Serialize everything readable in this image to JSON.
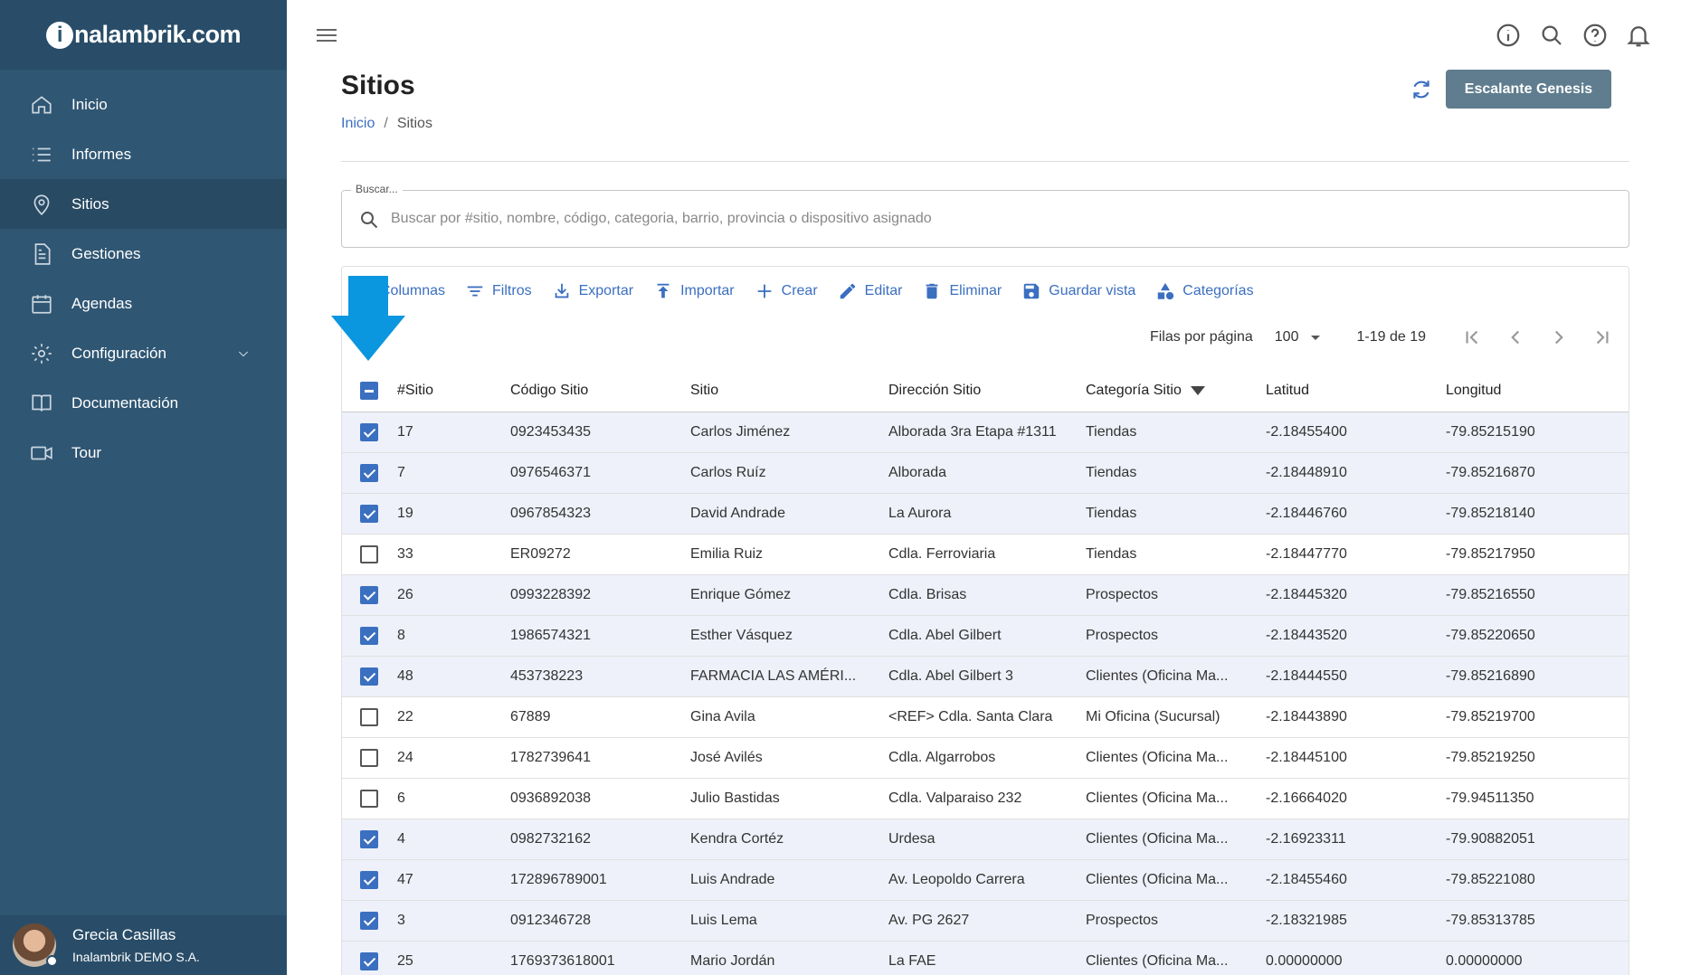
{
  "app": {
    "logo_text": "ınalambrik.com",
    "logo_letter": "i",
    "logo_rest": "nalambrik.com"
  },
  "sidebar": {
    "items": [
      {
        "label": "Inicio",
        "icon": "home-icon"
      },
      {
        "label": "Informes",
        "icon": "list-icon"
      },
      {
        "label": "Sitios",
        "icon": "location-pin-icon",
        "active": true
      },
      {
        "label": "Gestiones",
        "icon": "document-icon"
      },
      {
        "label": "Agendas",
        "icon": "calendar-icon"
      },
      {
        "label": "Configuración",
        "icon": "gear-icon"
      },
      {
        "label": "Documentación",
        "icon": "book-icon"
      },
      {
        "label": "Tour",
        "icon": "video-camera-icon"
      }
    ],
    "user": {
      "name": "Grecia Casillas",
      "org": "Inalambrik DEMO S.A."
    }
  },
  "header": {
    "title": "Sitios",
    "breadcrumb": {
      "home": "Inicio",
      "sep": "/",
      "current": "Sitios"
    },
    "action_button": "Escalante Genesis"
  },
  "search": {
    "label": "Buscar...",
    "placeholder": "Buscar por #sitio, nombre, código, categoria, barrio, provincia o dispositivo asignado",
    "value": ""
  },
  "toolbar": {
    "columnas": "Columnas",
    "filtros": "Filtros",
    "exportar": "Exportar",
    "importar": "Importar",
    "crear": "Crear",
    "editar": "Editar",
    "eliminar": "Eliminar",
    "guardar": "Guardar vista",
    "categorias": "Categorías"
  },
  "pager": {
    "rows_label": "Filas por página",
    "rows_value": "100",
    "range": "1-19 de 19"
  },
  "table": {
    "headers": [
      "#Sitio",
      "Código Sitio",
      "Sitio",
      "Dirección Sitio",
      "Categoría Sitio",
      "Latitud",
      "Longitud"
    ],
    "rows": [
      {
        "checked": true,
        "cells": [
          "17",
          "0923453435",
          "Carlos Jiménez",
          "Alborada 3ra Etapa #1311",
          "Tiendas",
          "-2.18455400",
          "-79.85215190"
        ]
      },
      {
        "checked": true,
        "cells": [
          "7",
          "0976546371",
          "Carlos Ruíz",
          "Alborada",
          "Tiendas",
          "-2.18448910",
          "-79.85216870"
        ]
      },
      {
        "checked": true,
        "cells": [
          "19",
          "0967854323",
          "David Andrade",
          "La Aurora",
          "Tiendas",
          "-2.18446760",
          "-79.85218140"
        ]
      },
      {
        "checked": false,
        "cells": [
          "33",
          "ER09272",
          "Emilia Ruiz",
          "Cdla. Ferroviaria",
          "Tiendas",
          "-2.18447770",
          "-79.85217950"
        ]
      },
      {
        "checked": true,
        "cells": [
          "26",
          "0993228392",
          "Enrique Gómez",
          "Cdla. Brisas",
          "Prospectos",
          "-2.18445320",
          "-79.85216550"
        ]
      },
      {
        "checked": true,
        "cells": [
          "8",
          "1986574321",
          "Esther Vásquez",
          "Cdla. Abel Gilbert",
          "Prospectos",
          "-2.18443520",
          "-79.85220650"
        ]
      },
      {
        "checked": true,
        "cells": [
          "48",
          "453738223",
          "FARMACIA LAS AMÉRI...",
          "Cdla. Abel Gilbert 3",
          "Clientes (Oficina Ma...",
          "-2.18444550",
          "-79.85216890"
        ]
      },
      {
        "checked": false,
        "cells": [
          "22",
          "67889",
          "Gina Avila",
          "<REF> Cdla. Santa Clara",
          "Mi Oficina (Sucursal)",
          "-2.18443890",
          "-79.85219700"
        ]
      },
      {
        "checked": false,
        "cells": [
          "24",
          "1782739641",
          "José Avilés",
          "Cdla. Algarrobos",
          "Clientes (Oficina Ma...",
          "-2.18445100",
          "-79.85219250"
        ]
      },
      {
        "checked": false,
        "cells": [
          "6",
          "0936892038",
          "Julio Bastidas",
          "Cdla. Valparaiso 232",
          "Clientes (Oficina Ma...",
          "-2.16664020",
          "-79.94511350"
        ]
      },
      {
        "checked": true,
        "cells": [
          "4",
          "0982732162",
          "Kendra Cortéz",
          "Urdesa",
          "Clientes (Oficina Ma...",
          "-2.16923311",
          "-79.90882051"
        ]
      },
      {
        "checked": true,
        "cells": [
          "47",
          "172896789001",
          "Luis Andrade",
          "Av. Leopoldo Carrera",
          "Clientes (Oficina Ma...",
          "-2.18455460",
          "-79.85221080"
        ]
      },
      {
        "checked": true,
        "cells": [
          "3",
          "0912346728",
          "Luis Lema",
          "Av. PG 2627",
          "Prospectos",
          "-2.18321985",
          "-79.85313785"
        ]
      },
      {
        "checked": true,
        "cells": [
          "25",
          "1769373618001",
          "Mario Jordán",
          "La FAE",
          "Clientes (Oficina Ma...",
          "0.00000000",
          "0.00000000"
        ]
      }
    ]
  },
  "colors": {
    "sidebar": "#2f5673",
    "accent": "#3b6fc0",
    "arrow": "#0b96e0",
    "button": "#5f7d8e"
  }
}
